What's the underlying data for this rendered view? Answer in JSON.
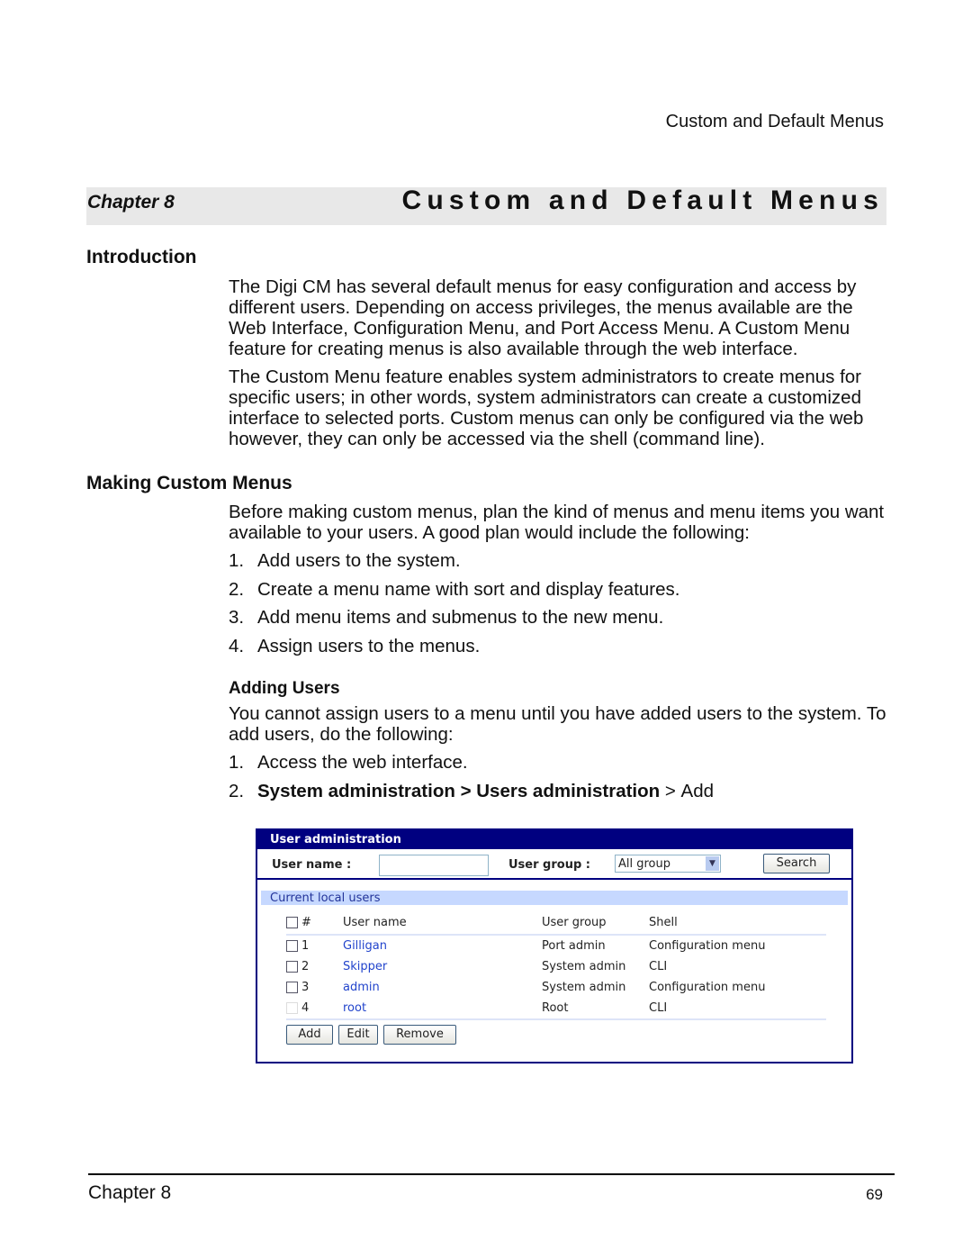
{
  "running_header": "Custom and Default Menus",
  "chapter_bar": {
    "label": "Chapter 8",
    "title": "Custom and Default Menus"
  },
  "intro": {
    "heading": "Introduction",
    "paragraphs": [
      "The Digi CM has several default menus for easy configuration and access by different users. Depending on access privileges, the menus available are the Web Interface, Configuration Menu, and Port Access Menu. A Custom Menu feature for creating menus is also available through the web interface.",
      "The Custom Menu feature enables system administrators to create menus for specific users; in other words, system administrators can create a customized interface to selected ports. Custom menus can only be configured via the web however, they can only be accessed via the shell (command line)."
    ]
  },
  "making": {
    "heading": "Making Custom Menus",
    "paragraph": "Before making custom menus, plan the kind of menus and menu items you want available to your users. A good plan would include the following:",
    "steps": [
      {
        "n": "1.",
        "text": "Add users to the system."
      },
      {
        "n": "2.",
        "text": "Create a menu name with sort and display features."
      },
      {
        "n": "3.",
        "text": "Add menu items and submenus to the new menu."
      },
      {
        "n": "4.",
        "text": "Assign users to the menus."
      }
    ]
  },
  "adding": {
    "heading": "Adding Users",
    "paragraph": "You cannot assign users to a menu until you have added users to the system. To add users, do the following:",
    "step1": {
      "n": "1.",
      "text": "Access the web interface."
    },
    "step2": {
      "n": "2.",
      "a": "System administration",
      "sep1": " > ",
      "b": "Users administration",
      "sep2": " > ",
      "c": "Add"
    }
  },
  "ui": {
    "title": "User administration",
    "username_label": "User name :",
    "username_value": "",
    "group_label": "User group :",
    "group_value": "All group",
    "search": "Search",
    "section": "Current local users",
    "columns": [
      "#",
      "User name",
      "User group",
      "Shell"
    ],
    "rows": [
      {
        "n": "1",
        "name": "Gilligan",
        "group": "Port admin",
        "shell": "Configuration menu"
      },
      {
        "n": "2",
        "name": "Skipper",
        "group": "System admin",
        "shell": "CLI"
      },
      {
        "n": "3",
        "name": "admin",
        "group": "System admin",
        "shell": "Configuration menu"
      },
      {
        "n": "4",
        "name": "root",
        "group": "Root",
        "shell": "CLI"
      }
    ],
    "buttons": {
      "add": "Add",
      "edit": "Edit",
      "remove": "Remove"
    }
  },
  "footer": {
    "chapter": "Chapter 8",
    "page": "69"
  }
}
